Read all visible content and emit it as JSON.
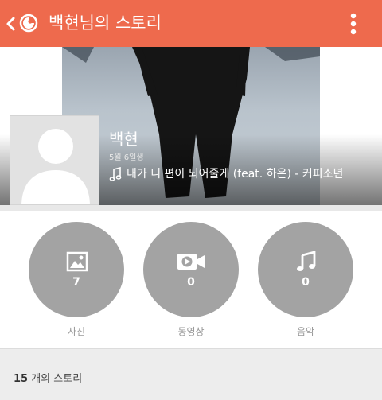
{
  "appbar": {
    "title": "백현님의 스토리",
    "icons": [
      "chevron-left-icon",
      "story-logo-icon",
      "more-vertical-icon"
    ],
    "color": "#ee6a4d"
  },
  "profile": {
    "name": "백현",
    "birthday": "5월 6일생",
    "song": "내가 니 편이 되어줄게 (feat. 하은) - 커피소년"
  },
  "stats": [
    {
      "icon": "photo-icon",
      "count": "7",
      "label": "사진"
    },
    {
      "icon": "video-icon",
      "count": "0",
      "label": "동영상"
    },
    {
      "icon": "music-icon",
      "count": "0",
      "label": "음악"
    }
  ],
  "stories": {
    "count": "15",
    "suffix": " 개의 스토리"
  },
  "colors": {
    "circle": "#a3a3a3",
    "label": "#999999"
  }
}
